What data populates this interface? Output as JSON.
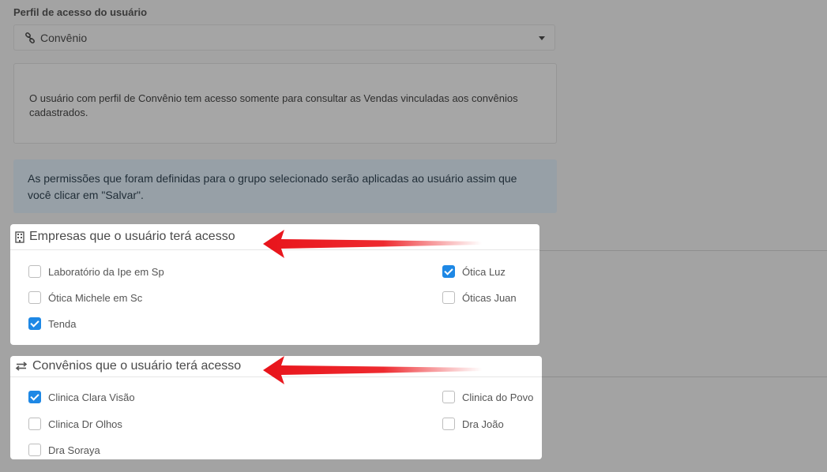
{
  "profile": {
    "label": "Perfil de acesso do usuário",
    "selected": "Convênio",
    "description": "O usuário com perfil de Convênio tem acesso somente para consultar as Vendas vinculadas aos convênios cadastrados."
  },
  "info": {
    "text": "As permissões que foram definidas para o grupo selecionado serão aplicadas ao usuário assim que você clicar em \"Salvar\"."
  },
  "empresas": {
    "title": "Empresas que o usuário terá acesso",
    "items": [
      {
        "label": "Laboratório da Ipe em Sp",
        "checked": false
      },
      {
        "label": "Ótica Luz",
        "checked": true
      },
      {
        "label": "Ótica Michele em Sc",
        "checked": false
      },
      {
        "label": "Óticas Juan",
        "checked": false
      },
      {
        "label": "Tenda",
        "checked": true
      }
    ]
  },
  "convenios": {
    "title": "Convênios que o usuário terá acesso",
    "items": [
      {
        "label": "Clinica Clara Visão",
        "checked": true
      },
      {
        "label": "Clinica do Povo",
        "checked": false
      },
      {
        "label": "Clinica Dr Olhos",
        "checked": false
      },
      {
        "label": "Dra João",
        "checked": false
      },
      {
        "label": "Dra Soraya",
        "checked": false
      }
    ]
  },
  "colors": {
    "checkbox_checked": "#1e88e5",
    "annotation_arrow": "#e8141b"
  }
}
